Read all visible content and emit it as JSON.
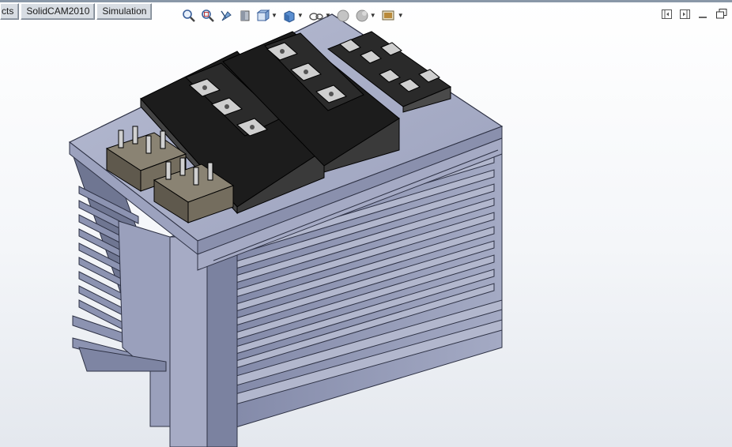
{
  "tabs": [
    {
      "label": "cts"
    },
    {
      "label": "SolidCAM2010"
    },
    {
      "label": "Simulation"
    }
  ],
  "heads_up_toolbar": {
    "buttons": [
      {
        "icon": "zoom-to-fit-icon",
        "dropdown": false
      },
      {
        "icon": "zoom-to-area-icon",
        "dropdown": false
      },
      {
        "icon": "previous-view-icon",
        "dropdown": false
      },
      {
        "icon": "section-view-icon",
        "dropdown": false
      },
      {
        "icon": "view-orientation-icon",
        "dropdown": true
      },
      {
        "icon": "display-style-icon",
        "dropdown": true
      },
      {
        "icon": "hide-show-items-icon",
        "dropdown": true
      },
      {
        "icon": "edit-appearance-icon",
        "dropdown": true
      },
      {
        "icon": "apply-scene-icon",
        "dropdown": true
      },
      {
        "icon": "view-settings-icon",
        "dropdown": true
      }
    ]
  },
  "window_controls": [
    "split-horizontal-icon",
    "split-vertical-icon",
    "minimize-icon",
    "restore-icon"
  ],
  "colors": {
    "heatsink_top": "#a9afc7",
    "heatsink_side": "#8c93b1",
    "heatsink_edge": "#2e3245",
    "module_body": "#232323",
    "module_top": "#1a1a1a",
    "terminal": "#c9c9c9",
    "rectifier_body": "#6d6659"
  }
}
